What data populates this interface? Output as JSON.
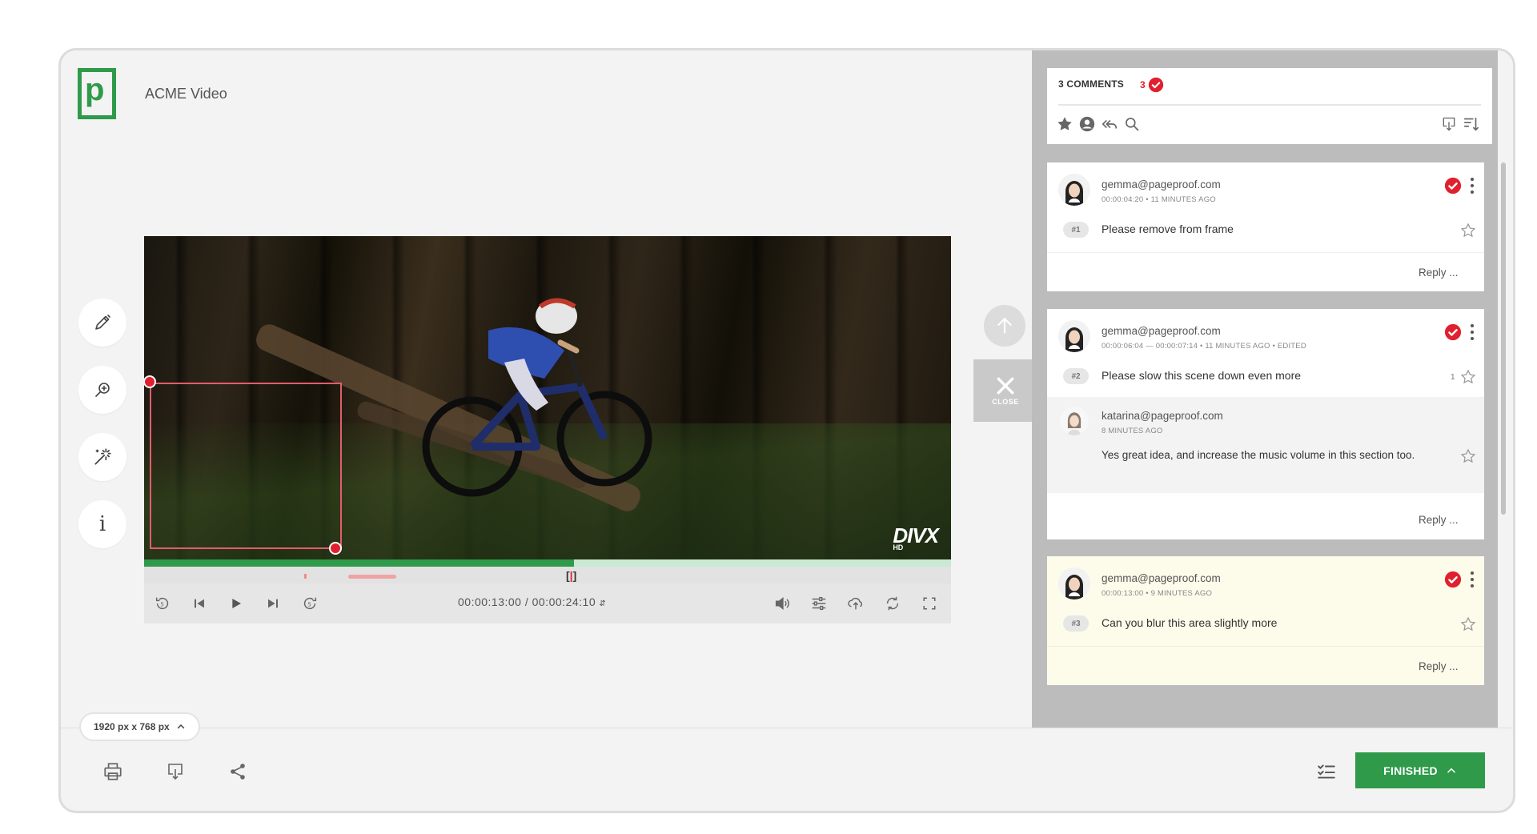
{
  "app": {
    "title": "ACME Video",
    "logo_letter": "p"
  },
  "player": {
    "timecode_current": "00:00:13:00",
    "timecode_total": "00:00:24:10",
    "timecode_separator": "/",
    "progress": 0.533,
    "brand_mark": "DIVX",
    "brand_sub": "HD"
  },
  "close_button": {
    "label": "CLOSE"
  },
  "bottom": {
    "size_label": "1920 px x 768 px",
    "finished_label": "FINISHED"
  },
  "comments_panel": {
    "count_label": "3 COMMENTS",
    "resolved_count": "3"
  },
  "comments": [
    {
      "email": "gemma@pageproof.com",
      "meta": "00:00:04:20  •  11 MINUTES AGO",
      "number": "#1",
      "text": "Please remove from frame",
      "reply_label": "Reply ..."
    },
    {
      "email": "gemma@pageproof.com",
      "meta": "00:00:06:04 — 00:00:07:14  •  11 MINUTES AGO  •  EDITED",
      "number": "#2",
      "text": "Please slow this scene down even more",
      "likes": "1",
      "reply": {
        "email": "katarina@pageproof.com",
        "meta": "8 MINUTES AGO",
        "text": "Yes great idea, and increase the music volume in this section too."
      },
      "reply_label": "Reply ..."
    },
    {
      "email": "gemma@pageproof.com",
      "meta": "00:00:13:00  •  9 MINUTES AGO",
      "number": "#3",
      "text": "Can you blur this area slightly more",
      "reply_label": "Reply ..."
    }
  ],
  "colors": {
    "brand_green": "#2f9a4a",
    "resolved_red": "#e0202e",
    "highlight": "#fdfbea"
  },
  "icons": [
    "pen-icon",
    "zoom-icon",
    "magic-wand-icon",
    "info-icon",
    "rewind-5-icon",
    "skip-back-icon",
    "play-icon",
    "skip-forward-icon",
    "forward-5-icon",
    "volume-icon",
    "settings-sliders-icon",
    "upload-icon",
    "loop-icon",
    "fullscreen-icon",
    "print-icon",
    "download-icon",
    "share-icon",
    "checklist-icon",
    "star-icon",
    "user-icon",
    "reply-all-icon",
    "search-icon",
    "sort-icon"
  ]
}
